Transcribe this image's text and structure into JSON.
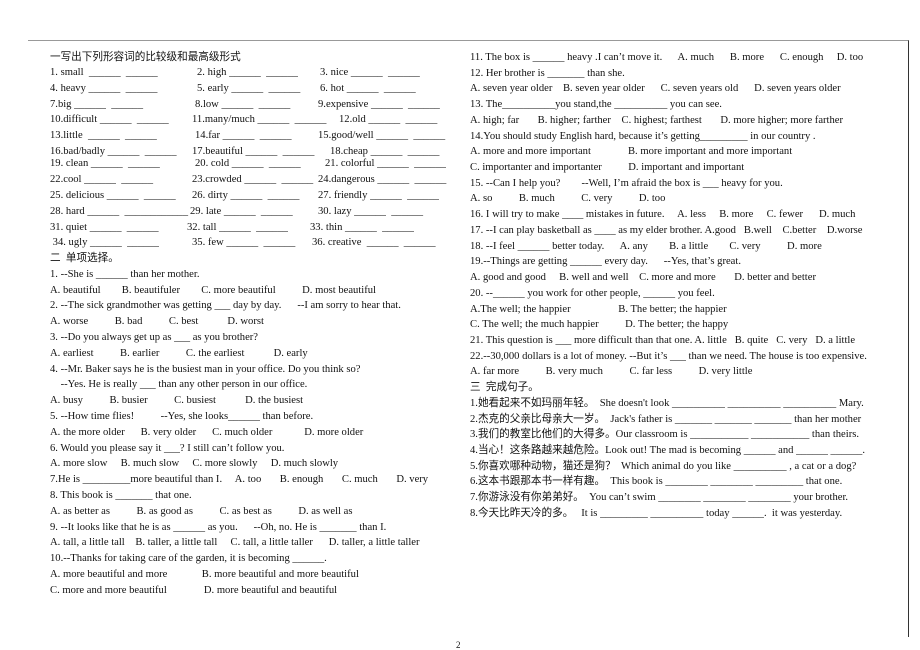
{
  "part1": {
    "heading": "一写出下列形容词的比较级和最高级形式",
    "rows": [
      [
        "1. small  ______  ______",
        "2. high ______  ______",
        "3. nice ______  ______"
      ],
      [
        "4. heavy ______  ______",
        "5. early ______  ______",
        "6. hot ______  ______"
      ],
      [
        "7.big ______  ______",
        "8.low ______  ______",
        "9.expensive ______  ______"
      ],
      [
        "10.difficult ______  ______",
        "11.many/much ______  ______",
        "12.old ______  ______"
      ],
      [
        "13.little  ______  ______",
        "14.far ______  ______",
        "15.good/well ______  ______"
      ],
      [
        "16.bad/badly ______  ______",
        "17.beautiful ______  ______",
        "18.cheap ______  ______"
      ],
      [
        "19. clean ______  ______",
        "20. cold ______  ______",
        "21. colorful ______  ______"
      ],
      [
        "22.cool ______  ______",
        "23.crowded ______  ______",
        "24.dangerous ______  ______"
      ],
      [
        "25. delicious ______  ______",
        "26. dirty ______  ______",
        "27. friendly ______  ______"
      ],
      [
        "28. hard ______  ____________",
        "29. late ______  ______",
        "30. lazy ______  ______"
      ],
      [
        "31. quiet ______  ______",
        "32. tall ______  ______",
        "33. thin ______  ______"
      ],
      [
        " 34. ugly ______  ______",
        "35. few ______  ______",
        "36. creative  ______  ______"
      ]
    ]
  },
  "left_lines": [
    "二  单项选择。",
    "1. --She is ______ than her mother.",
    "A. beautiful        B. beautifuler        C. more beautiful          D. most beautiful",
    "2. --The sick grandmother was getting ___ day by day.      --I am sorry to hear that.",
    "A. worse          B. bad          C. best           D. worst",
    "3. --Do you always get up as ___ as you brother?",
    "A. earliest          B. earlier          C. the earliest           D. early",
    "4. --Mr. Baker says he is the busiest man in your office. Do you think so?",
    "    --Yes. He is really ___ than any other person in our office.",
    "A. busy          B. busier          C. busiest           D. the busiest",
    "5. --How time flies!          --Yes, she looks______ than before.",
    "A. the more older      B. very older      C. much older            D. more older",
    "6. Would you please say it ___? I still can’t follow you.",
    "A. more slow     B. much slow     C. more slowly     D. much slowly",
    "7.He is _________more beautiful than I.     A. too       B. enough       C. much       D. very",
    "8. This book is _______ that one.",
    "A. as better as          B. as good as          C. as best as          D. as well as",
    "9. --It looks like that he is as ______ as you.      --Oh, no. He is _______ than I.",
    "A. tall, a little tall    B. taller, a little tall     C. tall, a little taller      D. taller, a little taller",
    "10.--Thanks for taking care of the garden, it is becoming ______.",
    "A. more beautiful and more             B. more beautiful and more beautiful",
    "C. more and more beautiful              D. more beautiful and beautiful"
  ],
  "right_lines": [
    "11. The box is ______ heavy .I can’t move it.      A. much      B. more      C. enough     D. too",
    "12. Her brother is _______ than she.",
    "A. seven year older    B. seven year older      C. seven years old      D. seven years older",
    "13. The__________you stand,the __________ you can see.",
    "A. high; far       B. higher; farther    C. highest; farthest       D. more higher; more farther",
    "14.You should study English hard, because it’s getting_________ in our country .",
    "A. more and more important              B. more important and more important",
    "C. importanter and importanter          D. important and important",
    "15. --Can I help you?        --Well, I’m afraid the box is ___ heavy for you.",
    "A. so          B. much          C. very          D. too",
    "16. I will try to make ____ mistakes in future.     A. less     B. more     C. fewer      D. much",
    "17. --I can play basketball as ____ as my elder brother. A.good   B.well    C.better    D.worse",
    "18. --I feel ______ better today.      A. any        B. a little        C. very          D. more",
    "19.--Things are getting ______ every day.      --Yes, that’s great.",
    "A. good and good     B. well and well    C. more and more       D. better and better",
    "20. --______ you work for other people, ______ you feel.",
    "A.The well; the happier                  B. The better; the happier",
    "C. The well; the much happier          D. The better; the happy",
    "21. This question is ___ more difficult than that one. A. little   B. quite   C. very   D. a little",
    "22.--30,000 dollars is a lot of money. --But it’s ___ than we need. The house is too expensive.",
    "A. far more          B. very much          C. far less          D. very little",
    "三  完成句子。",
    "1.她看起来不如玛丽年轻。  She doesn't look __________ __________ __________ Mary.",
    "2.杰克的父亲比母亲大一岁。  Jack's father is _______ _______ _______ than her mother",
    "3.我们的教室比他们的大得多。Our classroom is ___________ ___________ than theirs.",
    "4.当心！这条路越来越危险。Look out! The mad is becoming ______ and ______ ______.",
    "5.你喜欢哪种动物，猫还是狗？  Which animal do you like __________ , a cat or a dog?",
    "6.这本书跟那本书一样有趣。  This book is ________ ________ _________ that one.",
    "7.你游泳没有你弟弟好。  You can’t swim ________ ________ ________ your brother.",
    "8.今天比昨天冷的多。   It is _________ __________ today ______.  it was yesterday."
  ],
  "page_number": "2"
}
